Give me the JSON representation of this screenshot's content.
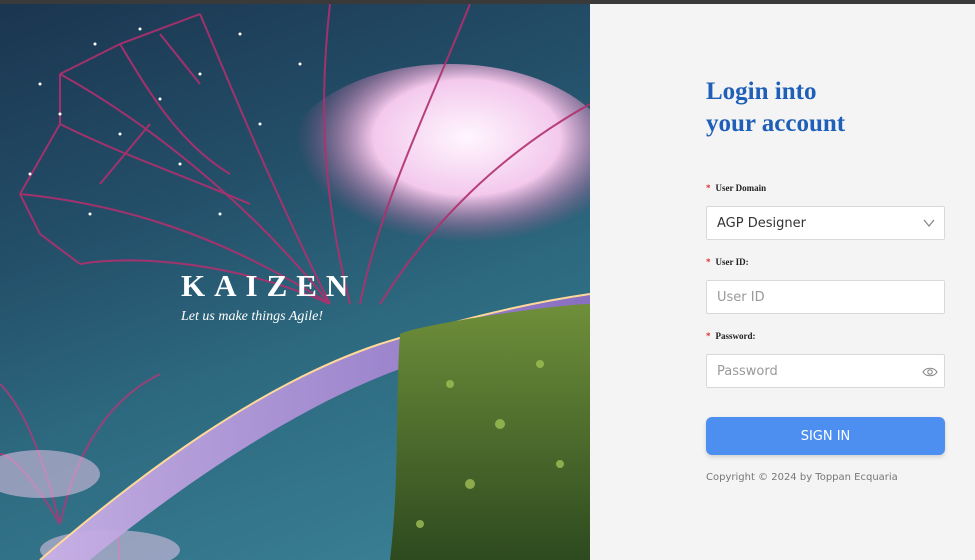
{
  "colors": {
    "accent": "#1f5fb8",
    "button": "#4d8ff0",
    "required": "#e03030"
  },
  "hero": {
    "brand": "KAIZEN",
    "tagline": "Let us make things Agile!"
  },
  "login": {
    "title_line1": "Login into",
    "title_line2": "your account",
    "domain_label": "User Domain",
    "domain_value": "AGP Designer",
    "userid_label": "User ID:",
    "userid_placeholder": "User ID",
    "password_label": "Password:",
    "password_placeholder": "Password",
    "required_mark": "*",
    "signin_label": "SIGN IN",
    "copyright": "Copyright © 2024 by Toppan Ecquaria"
  }
}
